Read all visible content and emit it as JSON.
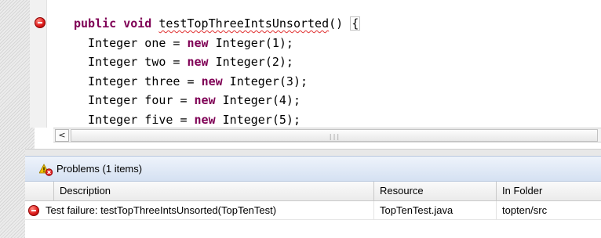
{
  "editor": {
    "lines": [
      {
        "tokens": [
          {
            "t": "public void ",
            "kw": true
          },
          {
            "t": "testTopThreeIntsUnsorted",
            "err": true
          },
          {
            "t": "() "
          },
          {
            "t": "{",
            "caret": true
          }
        ]
      },
      {
        "tokens": [
          {
            "t": "  Integer one = "
          },
          {
            "t": "new",
            "kw": true
          },
          {
            "t": " Integer(1);"
          }
        ]
      },
      {
        "tokens": [
          {
            "t": "  Integer two = "
          },
          {
            "t": "new",
            "kw": true
          },
          {
            "t": " Integer(2);"
          }
        ]
      },
      {
        "tokens": [
          {
            "t": "  Integer three = "
          },
          {
            "t": "new",
            "kw": true
          },
          {
            "t": " Integer(3);"
          }
        ]
      },
      {
        "tokens": [
          {
            "t": "  Integer four = "
          },
          {
            "t": "new",
            "kw": true
          },
          {
            "t": " Integer(4);"
          }
        ]
      },
      {
        "tokens": [
          {
            "t": "  Integer five = "
          },
          {
            "t": "new",
            "kw": true
          },
          {
            "t": " Integer(5);"
          }
        ]
      }
    ],
    "scroll_left_glyph": "<",
    "scroll_grip_glyph": "|||"
  },
  "problems": {
    "title": "Problems (1 items)",
    "columns": {
      "description": "Description",
      "resource": "Resource",
      "folder": "In Folder"
    },
    "rows": [
      {
        "description": "Test failure: testTopThreeIntsUnsorted(TopTenTest)",
        "resource": "TopTenTest.java",
        "folder": "topten/src"
      }
    ]
  },
  "colors": {
    "keyword": "#7f0055",
    "error_red": "#e02020",
    "header_blue": "#d5e1f2"
  },
  "icons": {
    "editor_marker": "error-icon",
    "view_icon": "problems-warning-icon",
    "row_icon": "error-icon"
  }
}
